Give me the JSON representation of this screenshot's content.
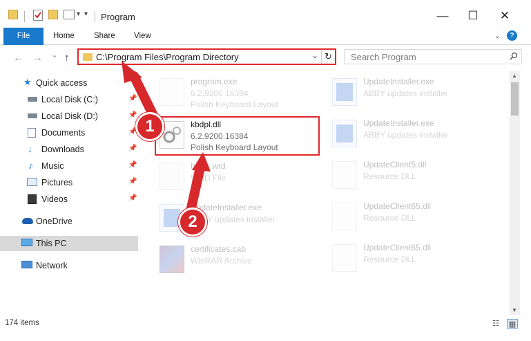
{
  "window": {
    "title": "Program",
    "minimize": "—",
    "maximize": "☐",
    "close": "✕",
    "dropdown_glyph": "▾"
  },
  "ribbon": {
    "tabs": [
      "File",
      "Home",
      "Share",
      "View"
    ],
    "collapse_glyph": "⌄",
    "help_glyph": "?"
  },
  "nav": {
    "back": "←",
    "forward": "→",
    "recent": "⌄",
    "up": "↑"
  },
  "address": {
    "path": "C:\\Program Files\\Program Directory",
    "dropdown": "⌄",
    "refresh": "↻"
  },
  "search": {
    "placeholder": "Search Program",
    "icon": "search-icon"
  },
  "sidebar": {
    "items": [
      {
        "label": "Quick access",
        "icon": "star-icon"
      },
      {
        "label": "Local Disk (C:)",
        "icon": "drive-icon",
        "pinned": true
      },
      {
        "label": "Local Disk (D:)",
        "icon": "drive-icon",
        "pinned": true
      },
      {
        "label": "Documents",
        "icon": "documents-icon",
        "pinned": true
      },
      {
        "label": "Downloads",
        "icon": "download-icon",
        "pinned": true
      },
      {
        "label": "Music",
        "icon": "music-icon",
        "pinned": true
      },
      {
        "label": "Pictures",
        "icon": "pictures-icon",
        "pinned": true
      },
      {
        "label": "Videos",
        "icon": "videos-icon",
        "pinned": true
      },
      {
        "label": "OneDrive",
        "icon": "cloud-icon"
      },
      {
        "label": "This PC",
        "icon": "pc-icon",
        "selected": true
      },
      {
        "label": "Network",
        "icon": "network-icon"
      }
    ],
    "pin_glyph": "📌"
  },
  "files": [
    {
      "name": "program.exe",
      "line2": "6.2.9200.16384",
      "line3": "Polish Keyboard Layout",
      "kind": "gear"
    },
    {
      "name": "kbdpl.dll",
      "line2": "6.2.9200.16384",
      "line3": "Polish Keyboard Layout",
      "kind": "gear",
      "highlight": true
    },
    {
      "name": "basic.wrd",
      "line2": "WRD File",
      "line3": "",
      "kind": "doc"
    },
    {
      "name": "UpdateInstaller.exe",
      "line2": "ABBY updates installer",
      "line3": "",
      "kind": "exe"
    },
    {
      "name": "certificates.cab",
      "line2": "WinRAR Archive",
      "line3": "",
      "kind": "cab"
    },
    {
      "name": "UpdateInstaller.exe",
      "line2": "ABBY updates installer",
      "line3": "",
      "kind": "exe"
    },
    {
      "name": "UpdateInstaller.exe",
      "line2": "ABBY updates installer",
      "line3": "",
      "kind": "exe"
    },
    {
      "name": "UpdateClient5.dll",
      "line2": "Resource DLL",
      "line3": "",
      "kind": "gear"
    },
    {
      "name": "UpdateClient65.dll",
      "line2": "Resource DLL",
      "line3": "",
      "kind": "gear"
    },
    {
      "name": "UpdateClient65.dll",
      "line2": "Resource DLL",
      "line3": "",
      "kind": "gear"
    }
  ],
  "status": {
    "count": "174 items",
    "details_view": "☷",
    "tiles_view": "▦"
  },
  "annotations": {
    "badge1": "1",
    "badge2": "2",
    "color": "#d7282c"
  },
  "colors": {
    "accent": "#1979ca",
    "highlight_border": "#e0272c",
    "selected_bg": "#d9d9d9"
  }
}
